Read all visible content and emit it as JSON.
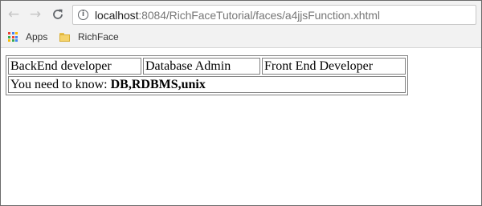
{
  "browser": {
    "nav": {
      "back_icon": "arrow-left-icon",
      "forward_icon": "arrow-right-icon",
      "reload_icon": "reload-icon"
    },
    "address_bar": {
      "info_icon": "info-icon",
      "host": "localhost",
      "path": ":8084/RichFaceTutorial/faces/a4jjsFunction.xhtml"
    },
    "bookmarks": [
      {
        "label": "Apps",
        "icon": "apps-grid-icon"
      },
      {
        "label": "RichFace",
        "icon": "folder-icon"
      }
    ],
    "apps_grid_colors": [
      "#ea4335",
      "#4285f4",
      "#fbbc05",
      "#34a853",
      "#ea4335",
      "#4285f4",
      "#fbbc05",
      "#34a853",
      "#4285f4"
    ]
  },
  "page": {
    "roles": [
      "BackEnd developer",
      "Database Admin",
      "Front End Developer"
    ],
    "knowledge_label": "You need to know: ",
    "knowledge_value": "DB,RDBMS,unix"
  }
}
